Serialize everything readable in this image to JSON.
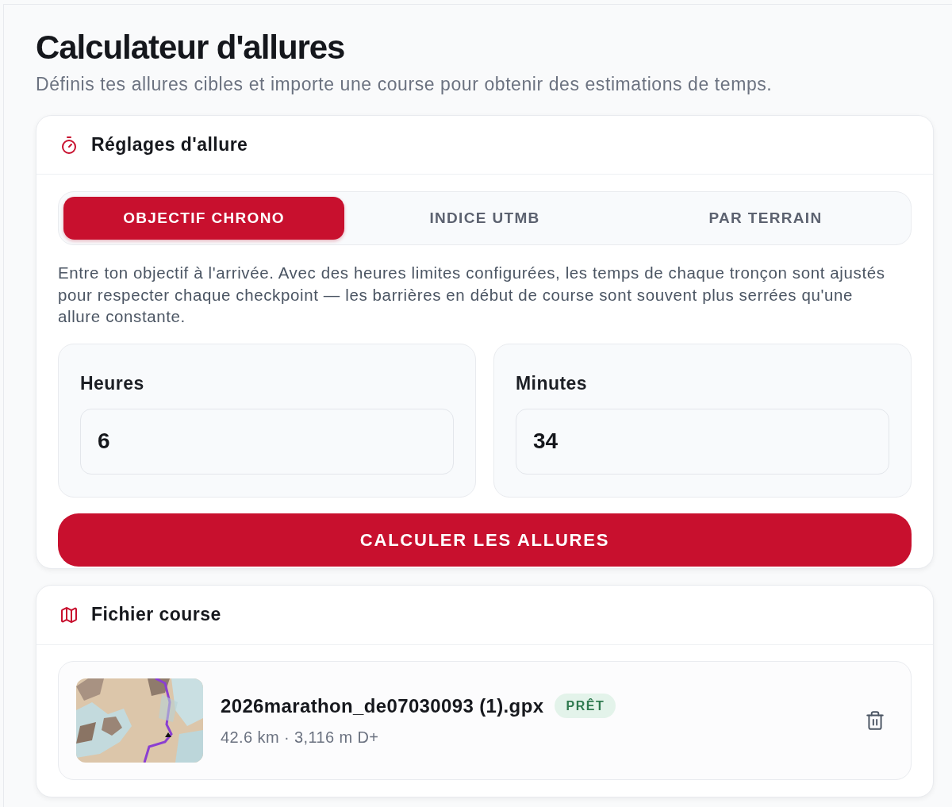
{
  "page": {
    "title": "Calculateur d'allures",
    "subtitle": "Définis tes allures cibles et importe une course pour obtenir des estimations de temps."
  },
  "settings": {
    "title": "Réglages d'allure",
    "tabs": [
      {
        "label": "OBJECTIF CHRONO",
        "selected": true
      },
      {
        "label": "INDICE UTMB",
        "selected": false
      },
      {
        "label": "PAR TERRAIN",
        "selected": false
      }
    ],
    "description": "Entre ton objectif à l'arrivée. Avec des heures limites configurées, les temps de chaque tronçon sont ajustés pour respecter chaque checkpoint — les barrières en début de course sont souvent plus serrées qu'une allure constante.",
    "fields": [
      {
        "label": "Heures",
        "value": "6"
      },
      {
        "label": "Minutes",
        "value": "34"
      }
    ],
    "submit_button": "CALCULER LES ALLURES"
  },
  "course_file": {
    "title": "Fichier course",
    "file": {
      "name": "2026marathon_de07030093 (1).gpx",
      "status": "PRÊT",
      "details": "42.6 km · 3,116 m D+"
    }
  }
}
